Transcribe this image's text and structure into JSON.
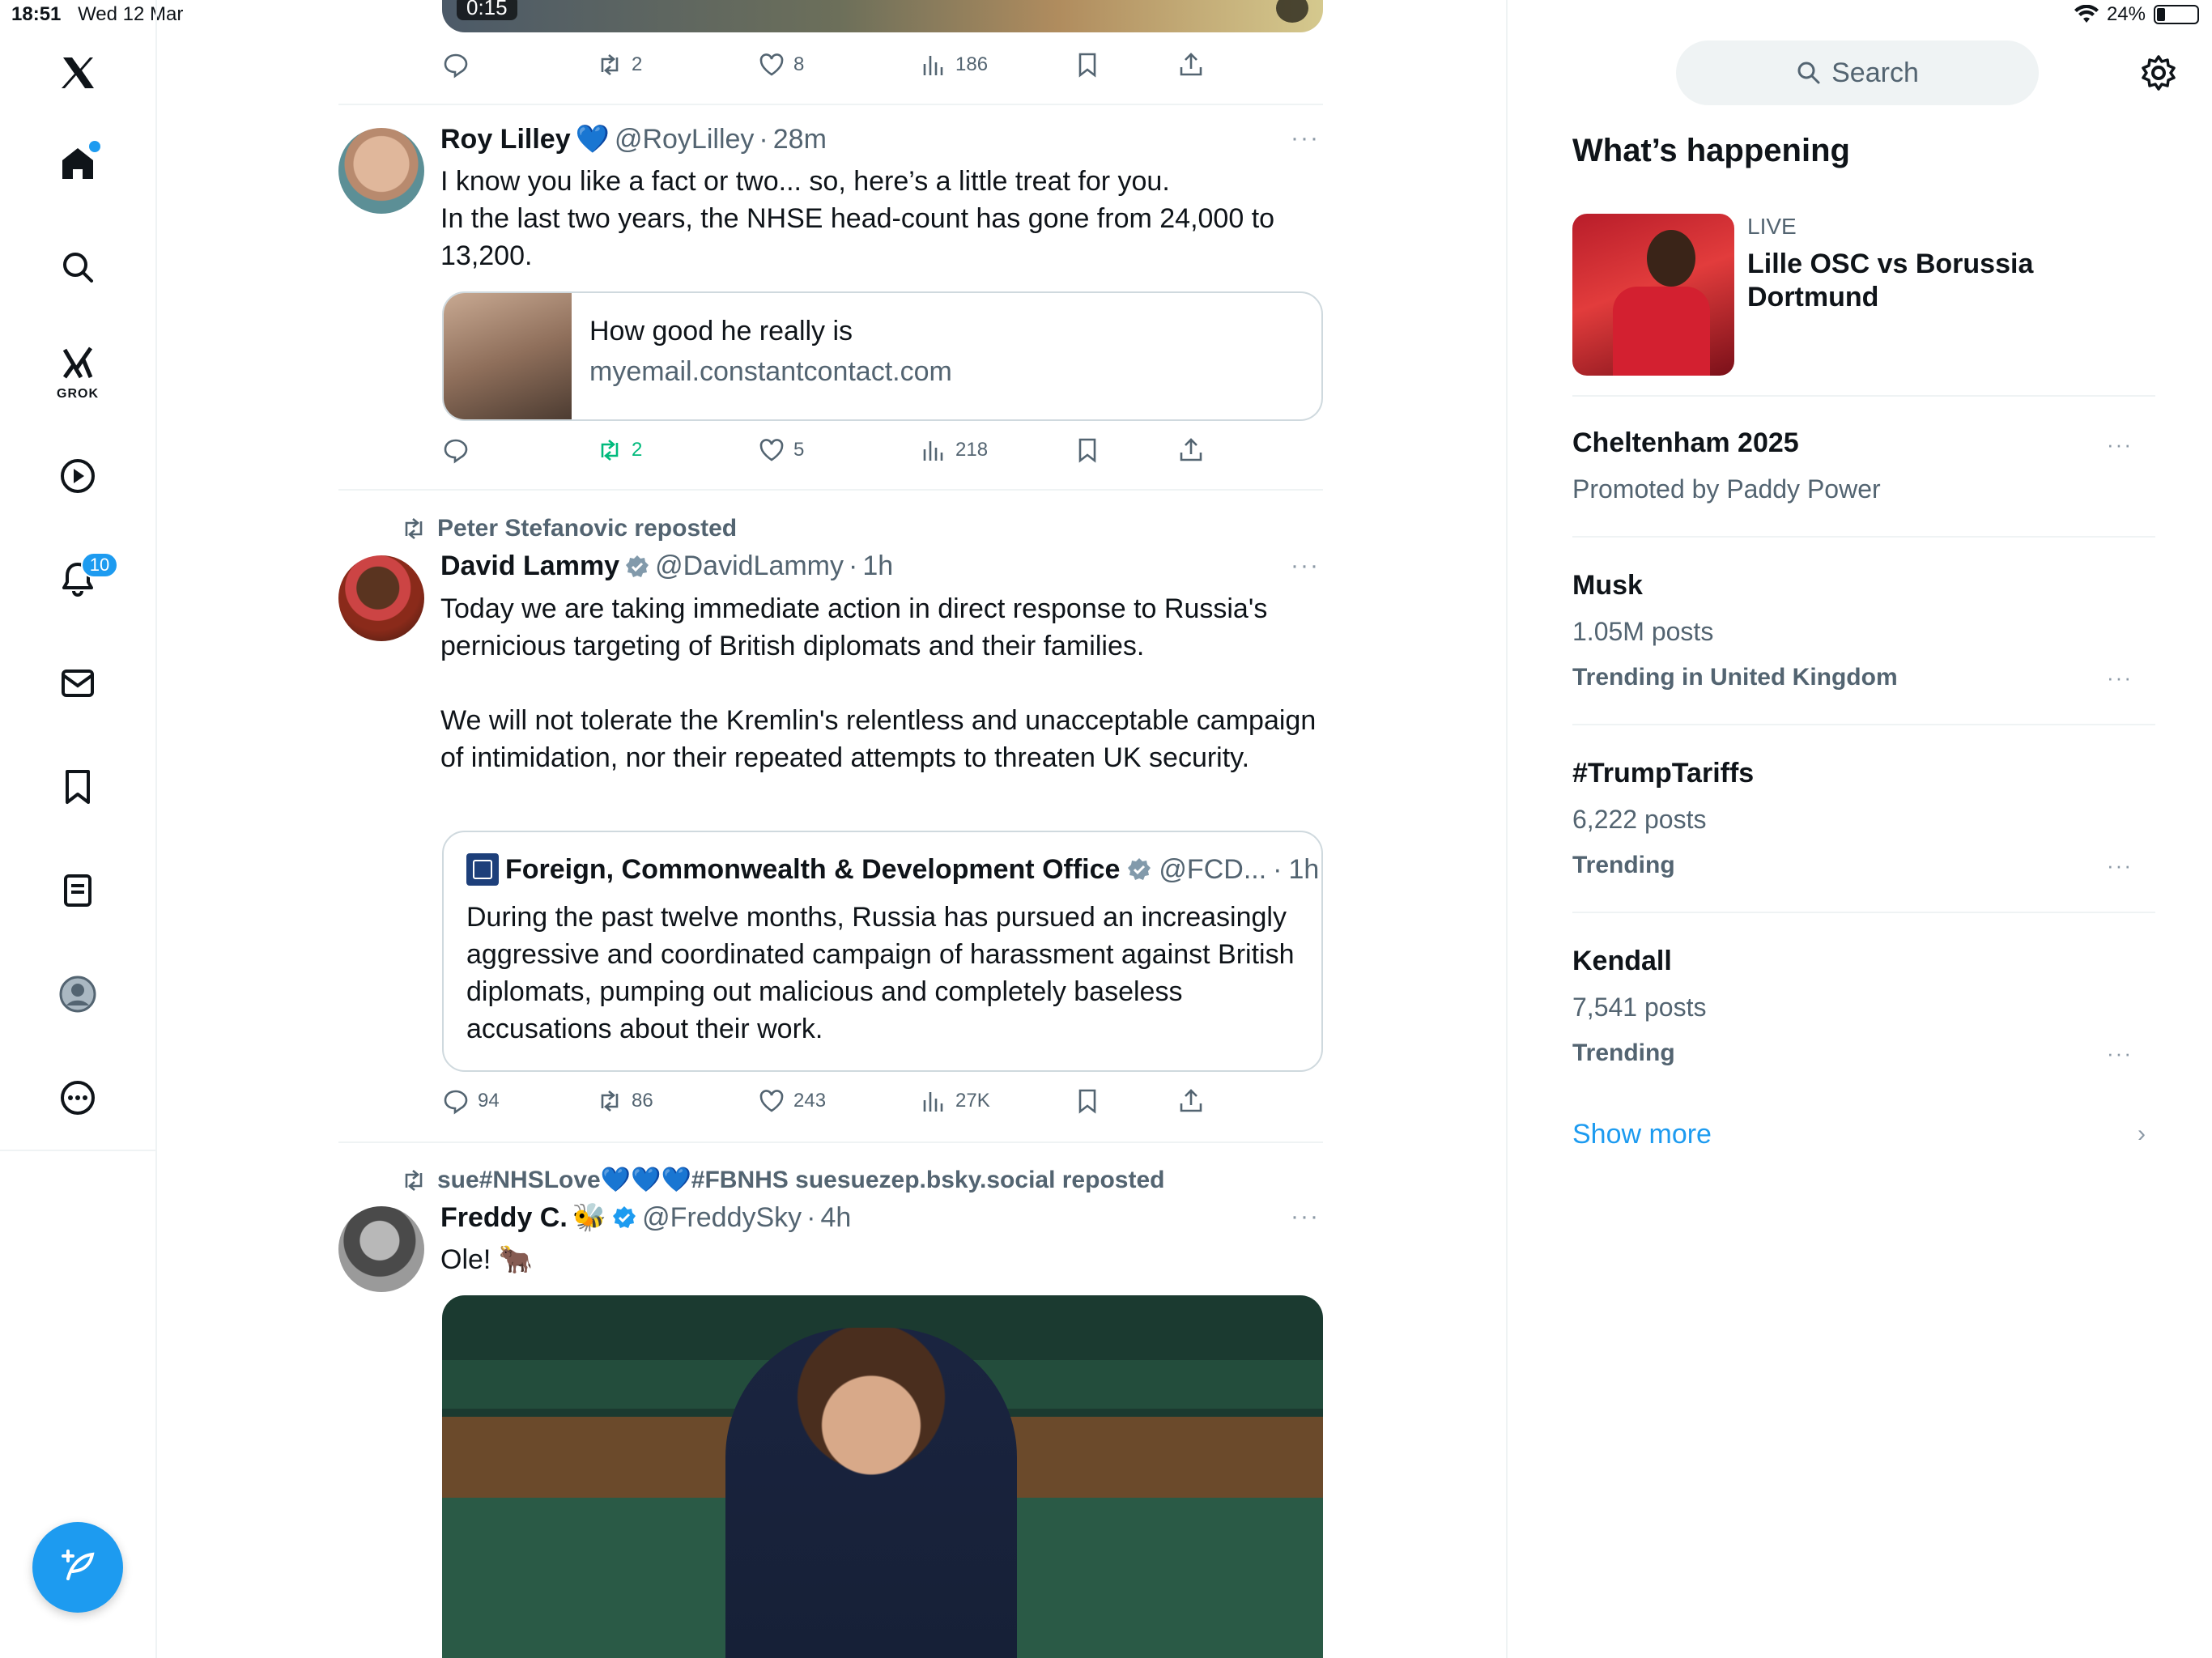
{
  "status_bar": {
    "time": "18:51",
    "date": "Wed 12 Mar",
    "battery": "24%",
    "wifi_icon": "wifi-icon"
  },
  "nav": {
    "logo_icon": "x-logo-icon",
    "items": [
      {
        "name": "home",
        "icon": "home-icon",
        "has_dot": true
      },
      {
        "name": "explore",
        "icon": "search-icon"
      },
      {
        "name": "grok",
        "icon": "grok-icon",
        "label": "GROK"
      },
      {
        "name": "video",
        "icon": "play-icon"
      },
      {
        "name": "notifications",
        "icon": "bell-icon",
        "badge": "10"
      },
      {
        "name": "messages",
        "icon": "mail-icon"
      },
      {
        "name": "bookmarks",
        "icon": "bookmark-icon"
      },
      {
        "name": "lists",
        "icon": "list-icon"
      },
      {
        "name": "profile",
        "icon": "profile-icon"
      },
      {
        "name": "more",
        "icon": "more-circle-icon"
      }
    ],
    "compose_icon": "compose-icon"
  },
  "feed": {
    "top_video": {
      "duration": "0:15",
      "icon": "mute-icon"
    },
    "top_actions": {
      "replies": "",
      "reposts": "2",
      "likes": "8",
      "views": "186"
    },
    "post1": {
      "name": "Roy Lilley",
      "name_suffix": "💙",
      "handle": "@RoyLilley",
      "time": "28m",
      "text": "I know you like a fact or two... so, here’s a little treat for you.\nIn the last two years, the NHSE head-count has gone from 24,000 to 13,200.",
      "link_title": "How good he really is",
      "link_domain": "myemail.constantcontact.com",
      "actions": {
        "replies": "",
        "reposts": "2",
        "likes": "5",
        "views": "218"
      }
    },
    "post2": {
      "repost_by": "Peter Stefanovic reposted",
      "name": "David Lammy",
      "handle": "@DavidLammy",
      "time": "1h",
      "text": "Today we are taking immediate action in direct response to Russia's pernicious targeting of British diplomats and their families.\n\nWe will not tolerate the Kremlin's relentless and unacceptable campaign of intimidation, nor their repeated attempts to threaten UK security.",
      "quote": {
        "name": "Foreign, Commonwealth & Development Office",
        "handle": "@FCD...",
        "time": "1h",
        "text": "During the past twelve months, Russia has pursued an increasingly aggressive and coordinated campaign of harassment against British diplomats, pumping out malicious and completely baseless accusations about their work."
      },
      "actions": {
        "replies": "94",
        "reposts": "86",
        "likes": "243",
        "views": "27K"
      }
    },
    "post3": {
      "repost_by": "sue#NHSLove💙💙💙#FBNHS suesuezep.bsky.social reposted",
      "name": "Freddy C.",
      "name_suffix": "🐝",
      "handle": "@FreddySky",
      "time": "4h",
      "text": "Ole! 🐂"
    }
  },
  "sidebar": {
    "search_placeholder": "Search",
    "title": "What’s happening",
    "live": {
      "label": "LIVE",
      "title": "Lille OSC vs Borussia Dortmund"
    },
    "trends": [
      {
        "title": "Cheltenham 2025",
        "sub": "Promoted by Paddy Power",
        "meta": ""
      },
      {
        "title": "Musk",
        "sub": "1.05M posts",
        "meta": "Trending in United Kingdom"
      },
      {
        "title": "#TrumpTariffs",
        "sub": "6,222 posts",
        "meta": "Trending"
      },
      {
        "title": "Kendall",
        "sub": "7,541 posts",
        "meta": "Trending"
      }
    ],
    "show_more": "Show more"
  },
  "colors": {
    "accent": "#1d9bf0",
    "text": "#0f1419",
    "muted": "#536471",
    "repost_active": "#00ba7c",
    "border": "#eff3f4"
  }
}
